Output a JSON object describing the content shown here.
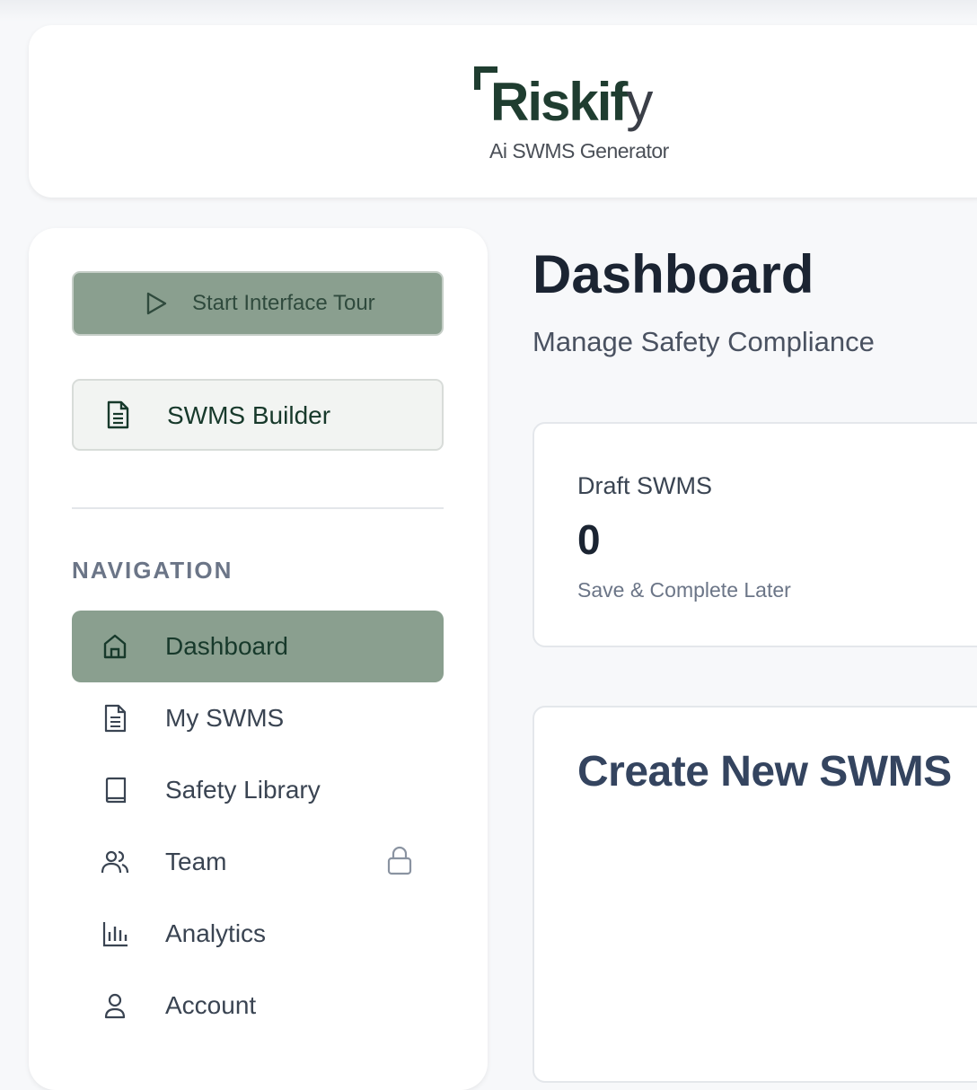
{
  "brand": {
    "name_main": "Riskif",
    "name_tail": "y",
    "tagline": "Ai SWMS Generator",
    "colors": {
      "primary": "#1f3d30",
      "accent": "#8a9f8f"
    }
  },
  "sidebar": {
    "tour_button": {
      "label": "Start Interface Tour",
      "icon": "play-icon"
    },
    "builder_button": {
      "label": "SWMS Builder",
      "icon": "document-icon"
    },
    "nav_heading": "NAVIGATION",
    "items": [
      {
        "label": "Dashboard",
        "icon": "home-icon",
        "active": true
      },
      {
        "label": "My SWMS",
        "icon": "document-icon"
      },
      {
        "label": "Safety Library",
        "icon": "book-icon"
      },
      {
        "label": "Team",
        "icon": "users-icon",
        "locked": true
      },
      {
        "label": "Analytics",
        "icon": "bar-chart-icon"
      },
      {
        "label": "Account",
        "icon": "user-icon"
      }
    ]
  },
  "main": {
    "title": "Dashboard",
    "subtitle": "Manage Safety Compliance",
    "stat_card": {
      "label": "Draft SWMS",
      "value": "0",
      "sub": "Save & Complete Later"
    },
    "create_card": {
      "title": "Create New SWMS"
    }
  }
}
